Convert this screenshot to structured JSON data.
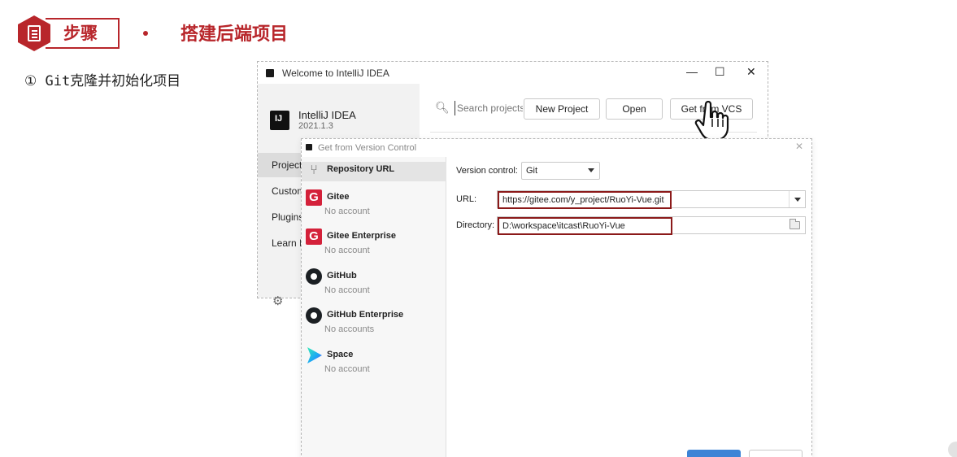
{
  "slide": {
    "step_label": "步骤",
    "title": "搭建后端项目",
    "substep": "① Git克隆并初始化项目",
    "accent": "#b8262b"
  },
  "welcome": {
    "title": "Welcome to IntelliJ IDEA",
    "controls": [
      "—",
      "☐",
      "✕"
    ],
    "product": "IntelliJ IDEA",
    "version": "2021.1.3",
    "nav": [
      "Projects",
      "Customize",
      "Plugins",
      "Learn IntelliJ IDEA"
    ],
    "search_placeholder": "Search projects",
    "buttons": {
      "new": "New Project",
      "open": "Open",
      "vcs": "Get from VCS"
    }
  },
  "vcs": {
    "title": "Get from Version Control",
    "sources": [
      {
        "name": "Repository URL",
        "icon": "fork-icon"
      },
      {
        "name": "Gitee",
        "sub": "No account",
        "icon": "gitee-icon"
      },
      {
        "name": "Gitee Enterprise",
        "sub": "No account",
        "icon": "gitee-icon"
      },
      {
        "name": "GitHub",
        "sub": "No account",
        "icon": "github-icon"
      },
      {
        "name": "GitHub Enterprise",
        "sub": "No accounts",
        "icon": "github-icon"
      },
      {
        "name": "Space",
        "sub": "No account",
        "icon": "space-icon"
      }
    ],
    "form": {
      "vc_label": "Version control:",
      "vc_value": "Git",
      "url_label": "URL:",
      "url_value": "https://gitee.com/y_project/RuoYi-Vue.git",
      "dir_label": "Directory:",
      "dir_value": "D:\\workspace\\itcast\\RuoYi-Vue"
    },
    "highlight_color": "#8b1a1a",
    "clone_button_color": "#3d84d6"
  }
}
